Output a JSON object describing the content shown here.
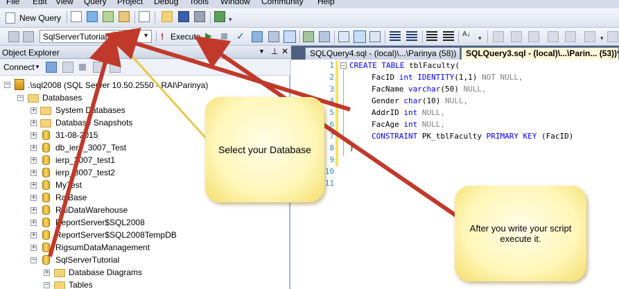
{
  "menu": [
    "File",
    "Edit",
    "View",
    "Query",
    "Project",
    "Debug",
    "Tools",
    "Window",
    "Community",
    "Help"
  ],
  "toolbar1": {
    "new_query_label": "New Query"
  },
  "toolbar2": {
    "database_selected": "SqlServerTutorial",
    "execute_label": "Execute"
  },
  "object_explorer": {
    "title": "Object Explorer",
    "connect_label": "Connect",
    "server_node": ".\\sql2008 (SQL Server 10.50.2550 - RAI\\Parinya)",
    "databases_label": "Databases",
    "items": [
      "System Databases",
      "Database Snapshots",
      "31-08-2015",
      "db_ierp_3007_Test",
      "ierp_3007_test1",
      "ierp_3007_test2",
      "MyTest",
      "RaiBase",
      "RaiDataWarehouse",
      "ReportServer$SQL2008",
      "ReportServer$SQL2008TempDB",
      "RigsumDataManagement",
      "SqlServerTutorial"
    ],
    "sub_items": [
      "Database Diagrams",
      "Tables"
    ]
  },
  "editor": {
    "tabs": [
      "SQLQuery4.sql - (local)\\...\\Parinya (58))",
      "SQLQuery3.sql - (local)\\...\\Parin... (53))*"
    ],
    "line_numbers": [
      "1",
      "2",
      "3",
      "4",
      "5",
      "6",
      "7",
      "8",
      "9",
      "10",
      "11"
    ],
    "code": {
      "l1_kw": "CREATE TABLE",
      "l1_rest": " tblFaculty(",
      "l2_a": "FacID ",
      "l2_kw": "int IDENTITY",
      "l2_b": "(1,1) ",
      "l2_gr": "NOT NULL,",
      "l3_a": "FacName ",
      "l3_kw": "varchar",
      "l3_b": "(50) ",
      "l3_gr": "NULL,",
      "l4_a": "Gender ",
      "l4_kw": "char",
      "l4_b": "(10) ",
      "l4_gr": "NULL,",
      "l5_a": "AddrID ",
      "l5_kw": "int",
      "l5_gr": " NULL,",
      "l6_a": "FacAge ",
      "l6_kw": "int",
      "l6_gr": " NULL,",
      "l7_kw1": "CONSTRAINT",
      "l7_a": " PK_tblFaculty ",
      "l7_kw2": "PRIMARY KEY",
      "l7_b": " (FacID)",
      "l8": ")"
    }
  },
  "callouts": {
    "select_db": "Select your Database",
    "execute_it": "After you write your script execute it."
  },
  "colors": {
    "arrow": "#c0392b",
    "callout_fill": "#fff6b8",
    "tab_active": "#fff8d8"
  }
}
